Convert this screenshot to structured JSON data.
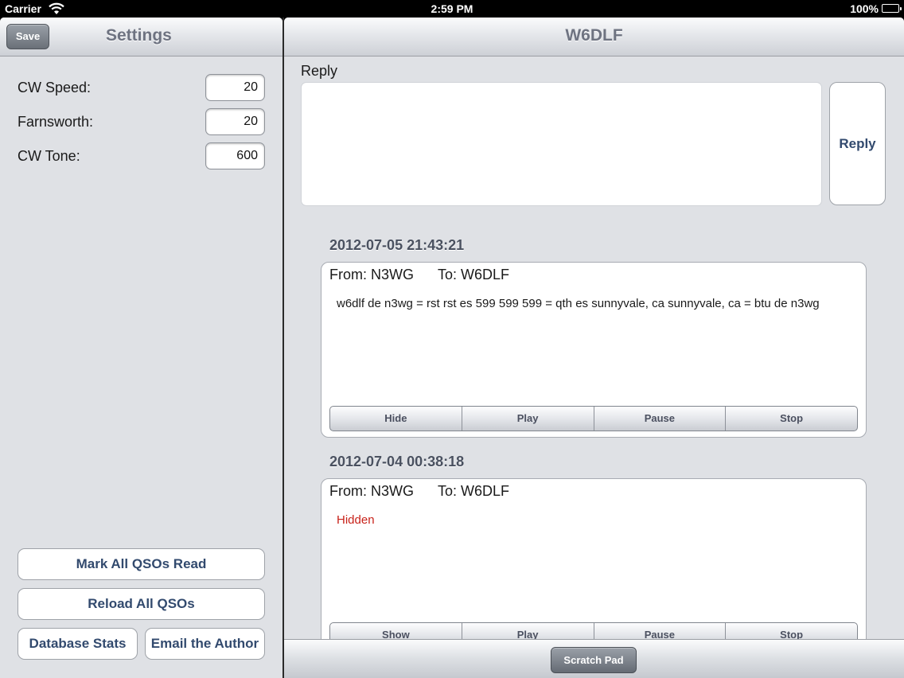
{
  "status_bar": {
    "carrier": "Carrier",
    "time": "2:59 PM",
    "battery": "100%"
  },
  "settings": {
    "title": "Settings",
    "save_label": "Save",
    "fields": [
      {
        "label": "CW Speed:",
        "value": "20"
      },
      {
        "label": "Farnsworth:",
        "value": "20"
      },
      {
        "label": "CW Tone:",
        "value": "600"
      }
    ],
    "buttons": {
      "mark_all": "Mark All QSOs Read",
      "reload_all": "Reload All QSOs",
      "db_stats": "Database Stats",
      "email_author": "Email the Author"
    }
  },
  "detail": {
    "title": "W6DLF",
    "reply_label": "Reply",
    "reply_value": "",
    "reply_button": "Reply",
    "qsos": [
      {
        "date": "2012-07-05 21:43:21",
        "from": "From: N3WG",
        "to": "To: W6DLF",
        "body": "w6dlf de n3wg = rst rst es 599 599 599 = qth es sunnyvale, ca sunnyvale, ca = btu de n3wg",
        "controls": [
          "Hide",
          "Play",
          "Pause",
          "Stop"
        ]
      },
      {
        "date": "2012-07-04 00:38:18",
        "from": "From: N3WG",
        "to": "To: W6DLF",
        "body": "Hidden",
        "controls": [
          "Show",
          "Play",
          "Pause",
          "Stop"
        ]
      }
    ],
    "scratch_pad": "Scratch Pad"
  },
  "colors": {
    "accent_text": "#324a6e",
    "hidden_text": "#c8221a",
    "panel_bg": "#dfe1e5"
  }
}
